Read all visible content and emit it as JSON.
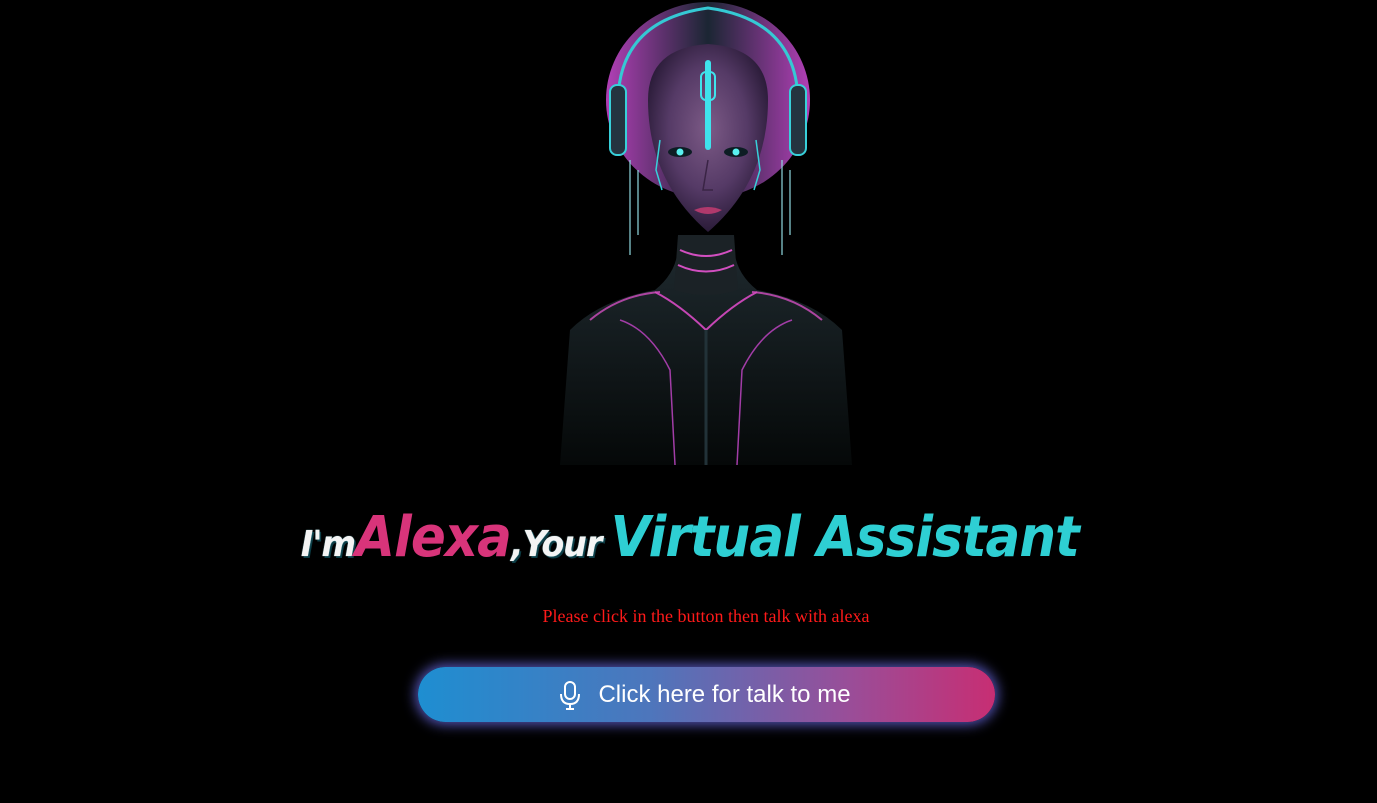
{
  "avatar": {
    "icon": "cyber-woman-avatar-illustration"
  },
  "headline": {
    "im": "I'm ",
    "name": "Alexa",
    "your": ",Your ",
    "role": "Virtual Assistant"
  },
  "instruction": "Please click in the button then talk with alexa",
  "talk_button": {
    "label": "Click here for talk to me",
    "icon": "microphone-icon"
  },
  "colors": {
    "background": "#000000",
    "name_pink": "#d8347a",
    "role_cyan": "#2ecfd3",
    "instruction_red": "#ff1a1a",
    "button_gradient_start": "#1e8ed1",
    "button_gradient_end": "#c72e73"
  }
}
